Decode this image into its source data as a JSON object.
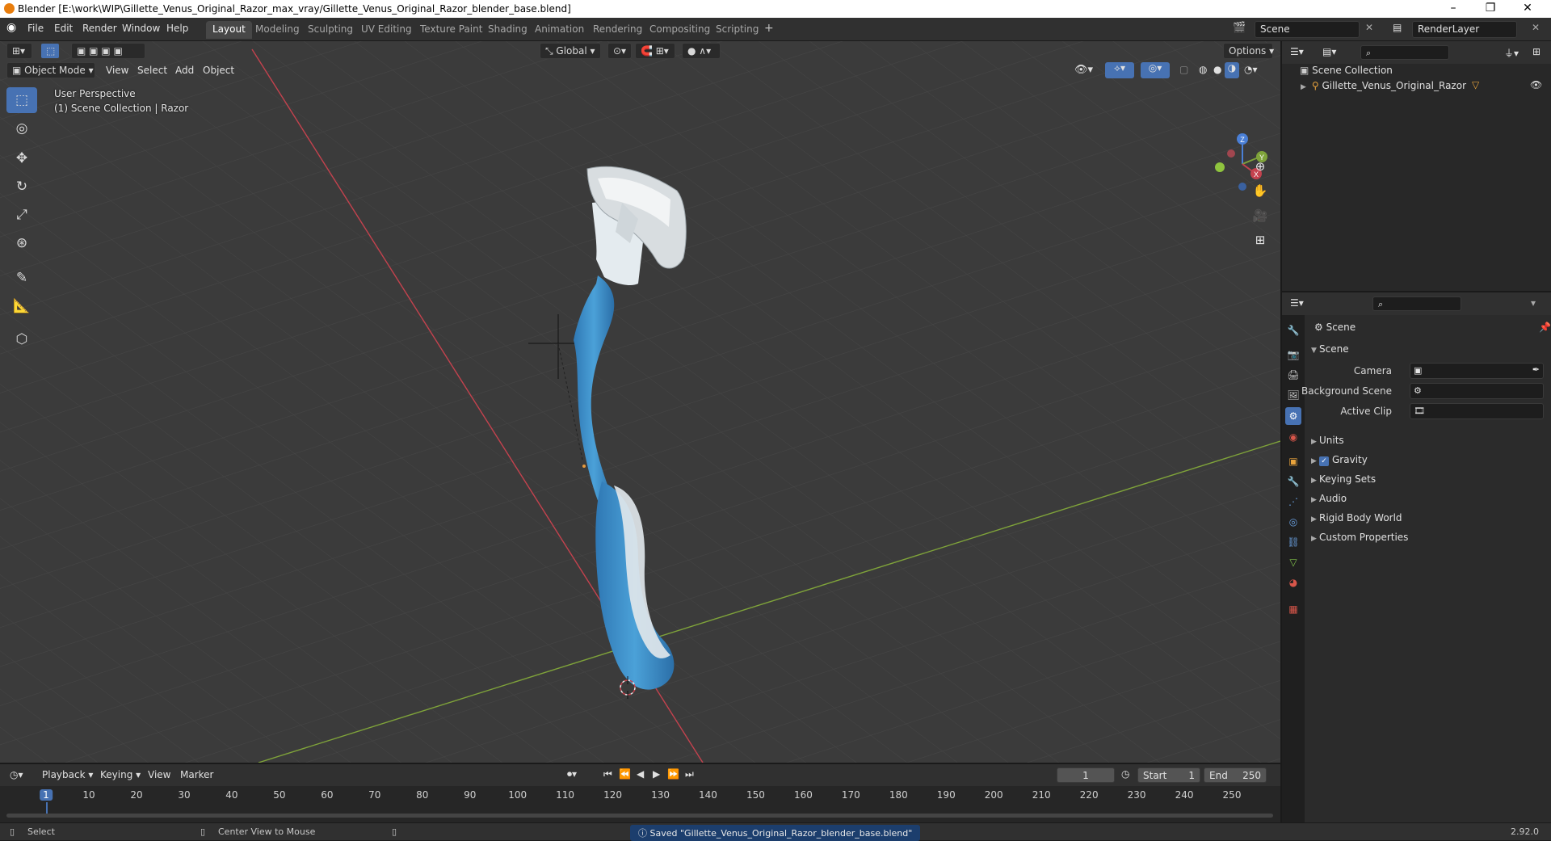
{
  "window": {
    "title": "Blender [E:\\work\\WIP\\Gillette_Venus_Original_Razor_max_vray/Gillette_Venus_Original_Razor_blender_base.blend]",
    "controls": [
      "–",
      "❐",
      "✕"
    ]
  },
  "menu": [
    "File",
    "Edit",
    "Render",
    "Window",
    "Help"
  ],
  "workspaces": {
    "tabs": [
      "Layout",
      "Modeling",
      "Sculpting",
      "UV Editing",
      "Texture Paint",
      "Shading",
      "Animation",
      "Rendering",
      "Compositing",
      "Scripting"
    ],
    "active": "Layout",
    "add": "+"
  },
  "scene_selector": {
    "value": "Scene"
  },
  "renderlayer_selector": {
    "value": "RenderLayer"
  },
  "viewport": {
    "transform_orientation": "Global",
    "options": "Options",
    "mode": "Object Mode",
    "menus": [
      "View",
      "Select",
      "Add",
      "Object"
    ],
    "overlay_title": "User Perspective",
    "overlay_sub": "(1) Scene Collection | Razor",
    "gizmo_axes": {
      "x": "X",
      "y": "Y",
      "z": "Z"
    }
  },
  "outliner": {
    "root": "Scene Collection",
    "items": [
      {
        "label": "Gillette_Venus_Original_Razor"
      }
    ]
  },
  "properties": {
    "context_title": "Scene",
    "panel_title": "Scene",
    "fields": [
      {
        "label": "Camera",
        "value": ""
      },
      {
        "label": "Background Scene",
        "value": ""
      },
      {
        "label": "Active Clip",
        "value": ""
      }
    ],
    "sections": [
      "Units",
      "Gravity",
      "Keying Sets",
      "Audio",
      "Rigid Body World",
      "Custom Properties"
    ],
    "gravity_checked": true
  },
  "timeline": {
    "menus": [
      "Playback",
      "Keying",
      "View",
      "Marker"
    ],
    "current_frame": "1",
    "start_label": "Start",
    "start": "1",
    "end_label": "End",
    "end": "250",
    "ticks": [
      "1",
      "10",
      "20",
      "30",
      "40",
      "50",
      "60",
      "70",
      "80",
      "90",
      "100",
      "110",
      "120",
      "130",
      "140",
      "150",
      "160",
      "170",
      "180",
      "190",
      "200",
      "210",
      "220",
      "230",
      "240",
      "250"
    ]
  },
  "statusbar": {
    "left": "Select",
    "middle": "Center View to Mouse",
    "message": "Saved \"Gillette_Venus_Original_Razor_blender_base.blend\"",
    "version": "2.92.0"
  },
  "colors": {
    "accent": "#4772b3",
    "x_axis": "#c4424e",
    "y_axis": "#7fa33a",
    "z_axis": "#4a7fd6",
    "razor_handle": "#3d8fc8",
    "razor_white": "#dfe6ea"
  }
}
